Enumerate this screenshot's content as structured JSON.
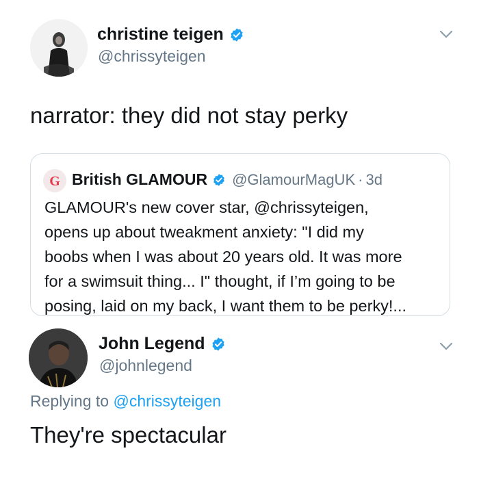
{
  "tweets": [
    {
      "author": {
        "name": "christine teigen",
        "handle": "@chrissyteigen",
        "verified": true
      },
      "text": "narrator: they did not stay perky",
      "quoted_tweet": {
        "author": {
          "name": "British GLAMOUR",
          "handle": "@GlamourMagUK",
          "verified": true
        },
        "separator": "·",
        "time": "3d",
        "text_lines": [
          "GLAMOUR's new cover star, @chrissyteigen,",
          "opens up about tweakment anxiety: \"I did my",
          "boobs when I was about 20 years old. It was more",
          "for a swimsuit thing... I\" thought, if I’m going to be",
          "posing, laid on my back, I want them to be perky!..."
        ]
      }
    },
    {
      "author": {
        "name": "John Legend",
        "handle": "@johnlegend",
        "verified": true
      },
      "reply_prefix": "Replying to",
      "reply_to": "@chrissyteigen",
      "text": "They're spectacular"
    }
  ],
  "icons": {
    "verified": "verified-badge-icon",
    "menu": "chevron-down-icon"
  },
  "colors": {
    "verified_blue": "#1da1f2",
    "secondary_text": "#657786",
    "link": "#1da1f2",
    "border": "#d5dde3"
  }
}
